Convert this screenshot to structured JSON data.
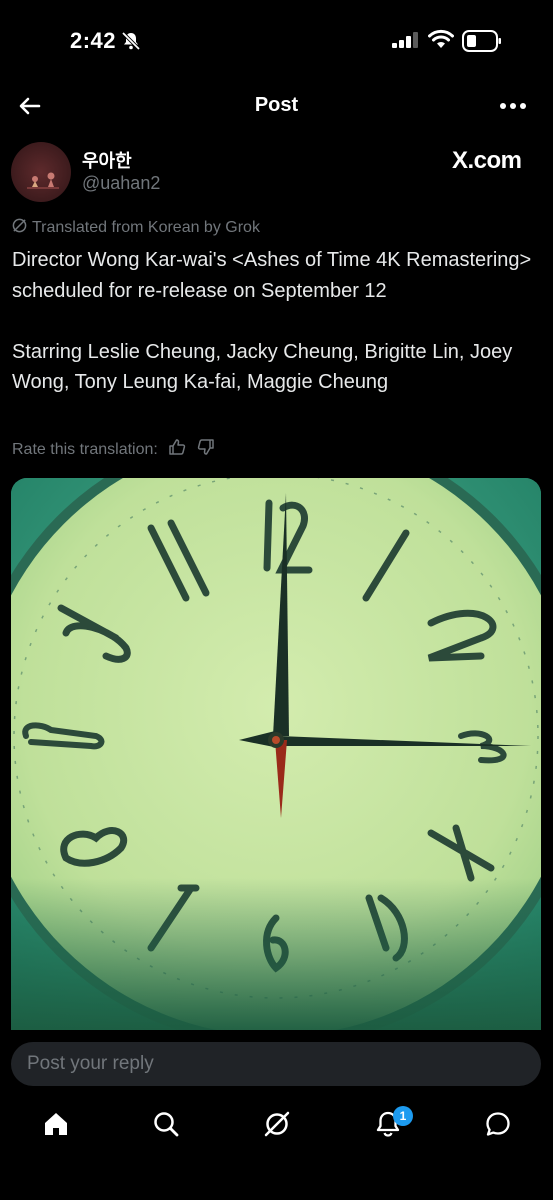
{
  "status_bar": {
    "time": "2:42"
  },
  "header": {
    "title": "Post"
  },
  "author": {
    "display_name": "우아한",
    "handle": "@uahan2"
  },
  "watermark": "X.com",
  "translation_notice": "Translated from Korean by Grok",
  "post": {
    "line1": "Director Wong Kar-wai's <Ashes of Time 4K Remastering> scheduled for re-release on September 12",
    "line2": "Starring Leslie Cheung, Jacky Cheung, Brigitte Lin, Joey Wong, Tony Leung Ka-fai, Maggie Cheung"
  },
  "rate_translation": "Rate this translation:",
  "reply": {
    "placeholder": "Post your reply"
  },
  "nav": {
    "items": [
      "home-icon",
      "search-icon",
      "grok-icon",
      "notifications-icon",
      "messages-icon"
    ],
    "notification_count": "1"
  },
  "colors": {
    "accent": "#1d9bf0",
    "background": "#000000",
    "muted": "#71767b",
    "clock_face": "#c9e6a2",
    "clock_bg": "#2b8f73"
  }
}
